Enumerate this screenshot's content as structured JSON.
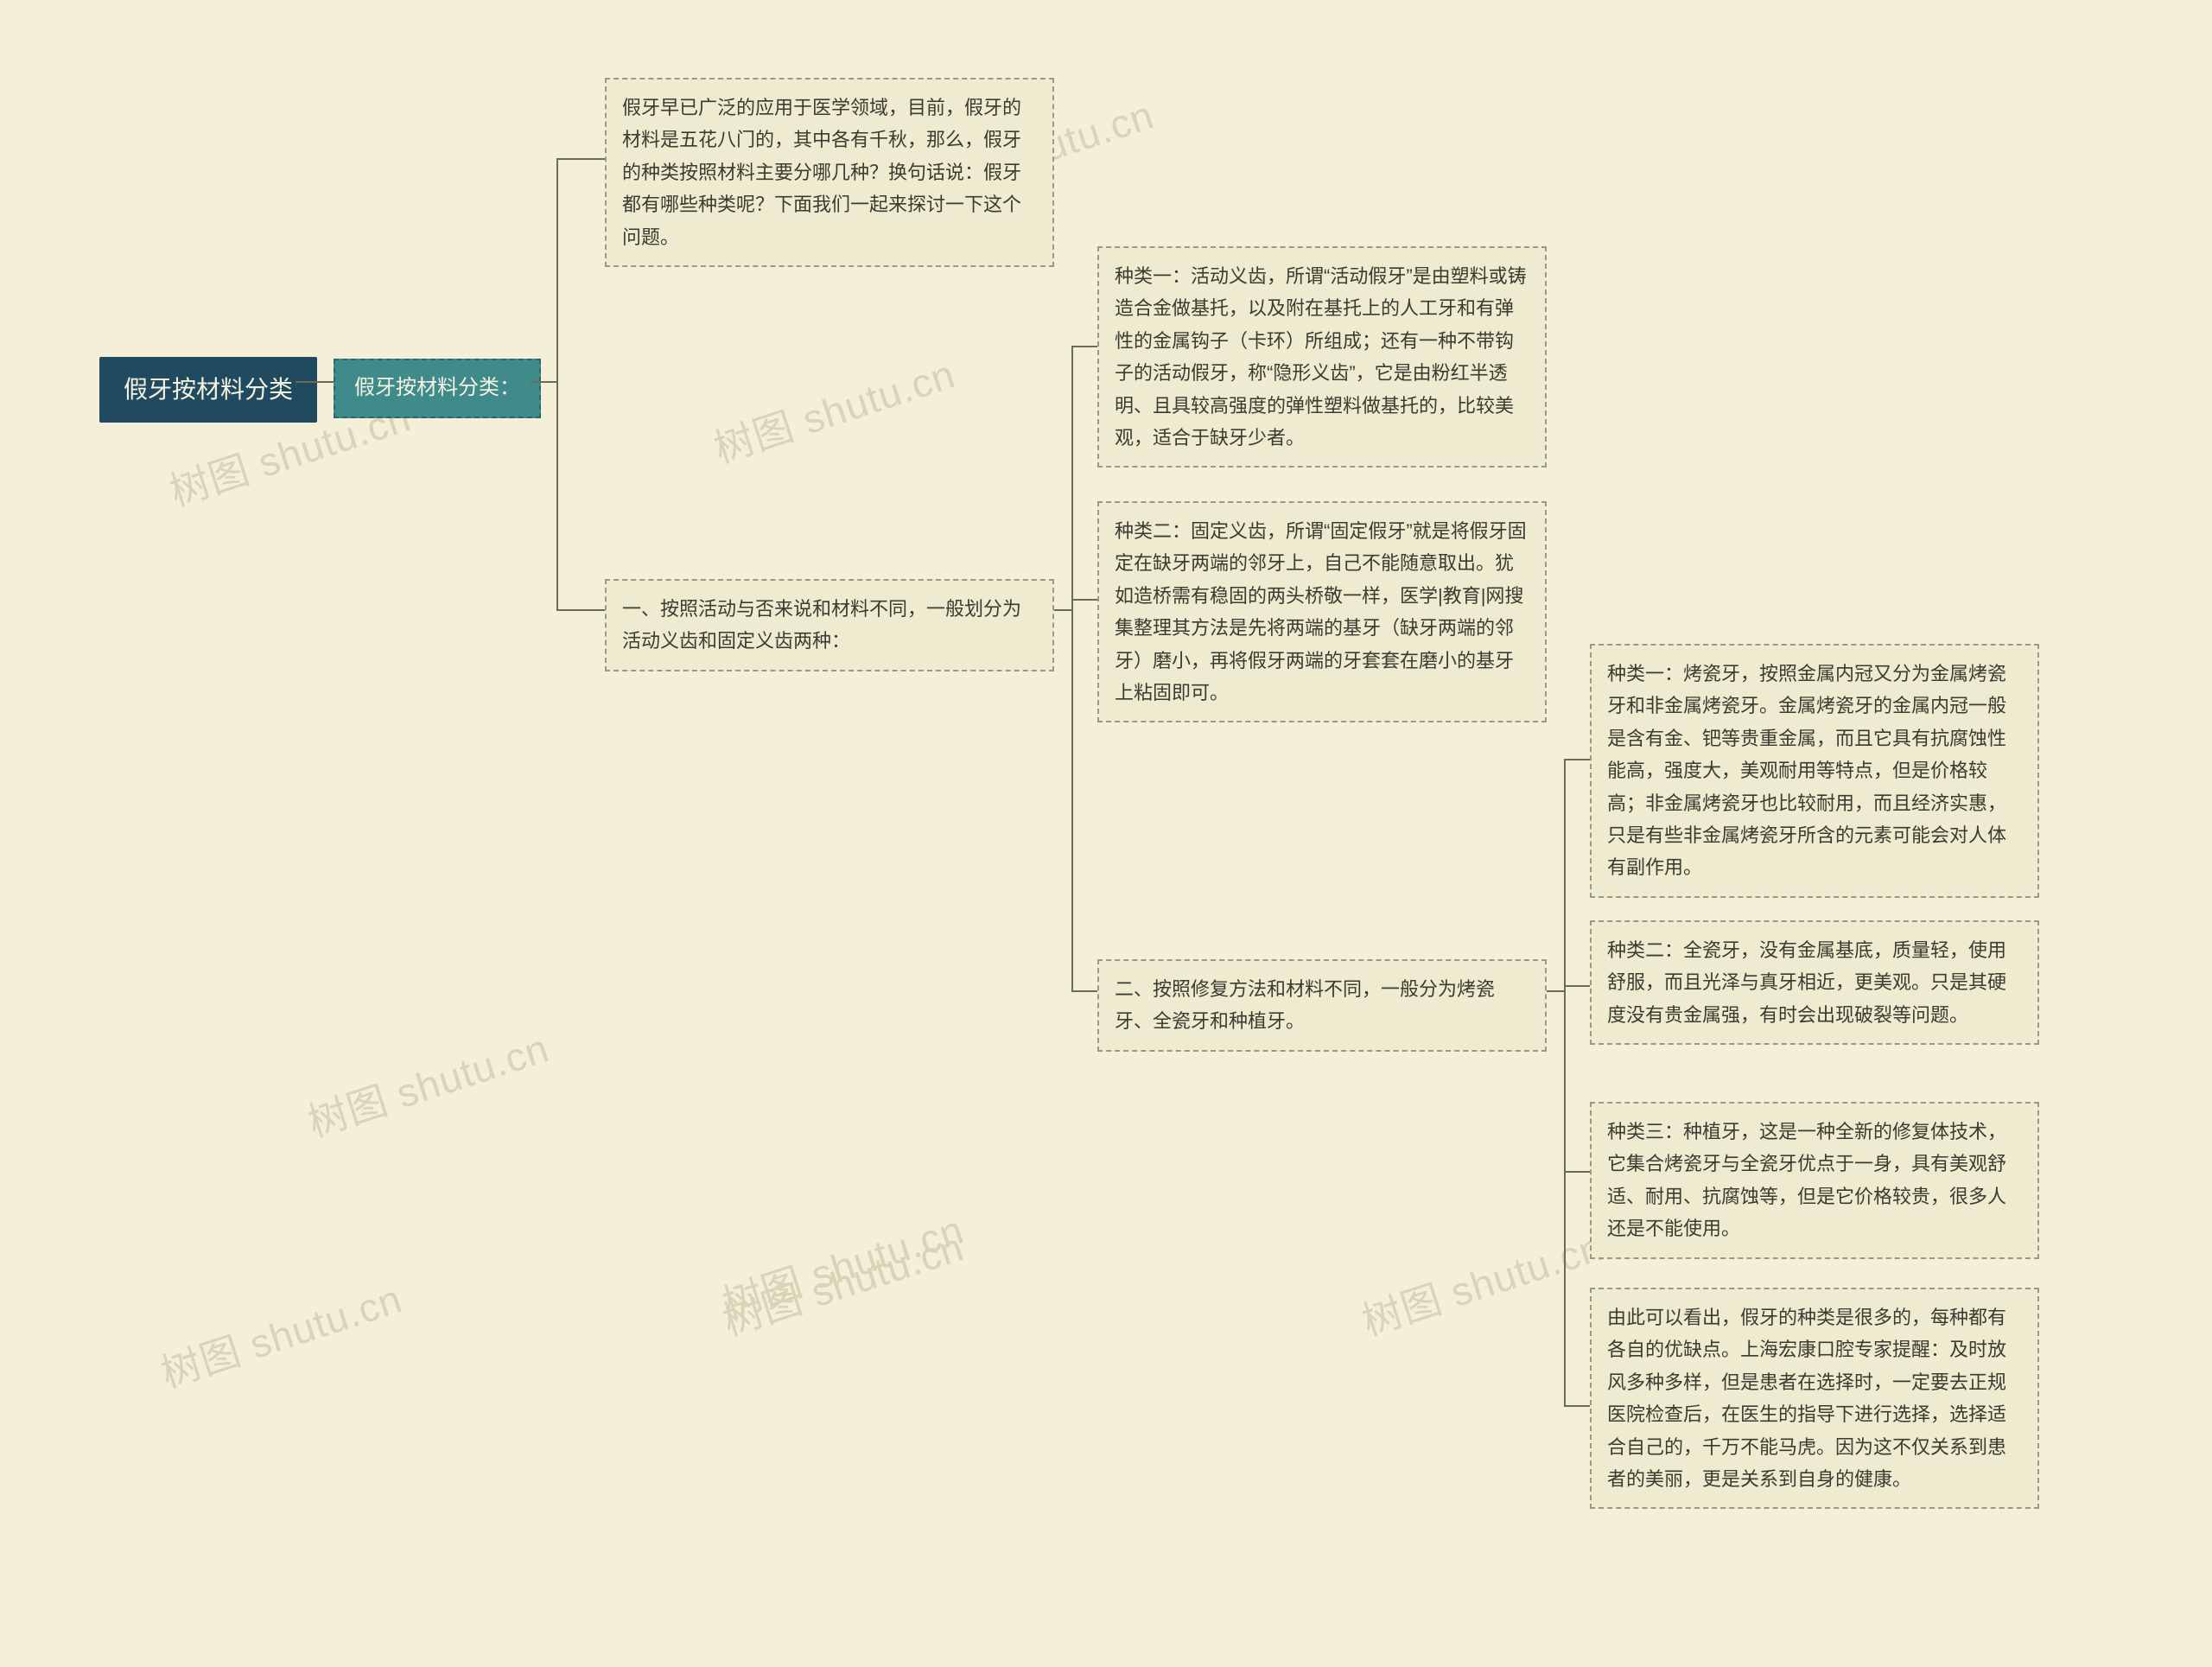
{
  "watermark": "树图 shutu.cn",
  "root": "假牙按材料分类",
  "level1": "假牙按材料分类：",
  "intro": "假牙早已广泛的应用于医学领域，目前，假牙的材料是五花八门的，其中各有千秋，那么，假牙的种类按照材料主要分哪几种？换句话说：假牙都有哪些种类呢？下面我们一起来探讨一下这个问题。",
  "cat1": {
    "title": "一、按照活动与否来说和材料不同，一般划分为活动义齿和固定义齿两种：",
    "items": [
      "种类一：活动义齿，所谓“活动假牙”是由塑料或铸造合金做基托，以及附在基托上的人工牙和有弹性的金属钩子（卡环）所组成；还有一种不带钩子的活动假牙，称“隐形义齿”，它是由粉红半透明、且具较高强度的弹性塑料做基托的，比较美观，适合于缺牙少者。",
      "种类二：固定义齿，所谓“固定假牙”就是将假牙固定在缺牙两端的邻牙上，自己不能随意取出。犹如造桥需有稳固的两头桥敬一样，医学|教育|网搜集整理其方法是先将两端的基牙（缺牙两端的邻牙）磨小，再将假牙两端的牙套套在磨小的基牙上粘固即可。"
    ]
  },
  "cat2": {
    "title": "二、按照修复方法和材料不同，一般分为烤瓷牙、全瓷牙和种植牙。",
    "items": [
      "种类一：烤瓷牙，按照金属内冠又分为金属烤瓷牙和非金属烤瓷牙。金属烤瓷牙的金属内冠一般是含有金、钯等贵重金属，而且它具有抗腐蚀性能高，强度大，美观耐用等特点，但是价格较高；非金属烤瓷牙也比较耐用，而且经济实惠，只是有些非金属烤瓷牙所含的元素可能会对人体有副作用。",
      "种类二：全瓷牙，没有金属基底，质量轻，使用舒服，而且光泽与真牙相近，更美观。只是其硬度没有贵金属强，有时会出现破裂等问题。",
      "种类三：种植牙，这是一种全新的修复体技术，它集合烤瓷牙与全瓷牙优点于一身，具有美观舒适、耐用、抗腐蚀等，但是它价格较贵，很多人还是不能使用。",
      "由此可以看出，假牙的种类是很多的，每种都有各自的优缺点。上海宏康口腔专家提醒：及时放风多种多样，但是患者在选择时，一定要去正规医院检查后，在医生的指导下进行选择，选择适合自己的，千万不能马虎。因为这不仅关系到患者的美丽，更是关系到自身的健康。"
    ]
  }
}
